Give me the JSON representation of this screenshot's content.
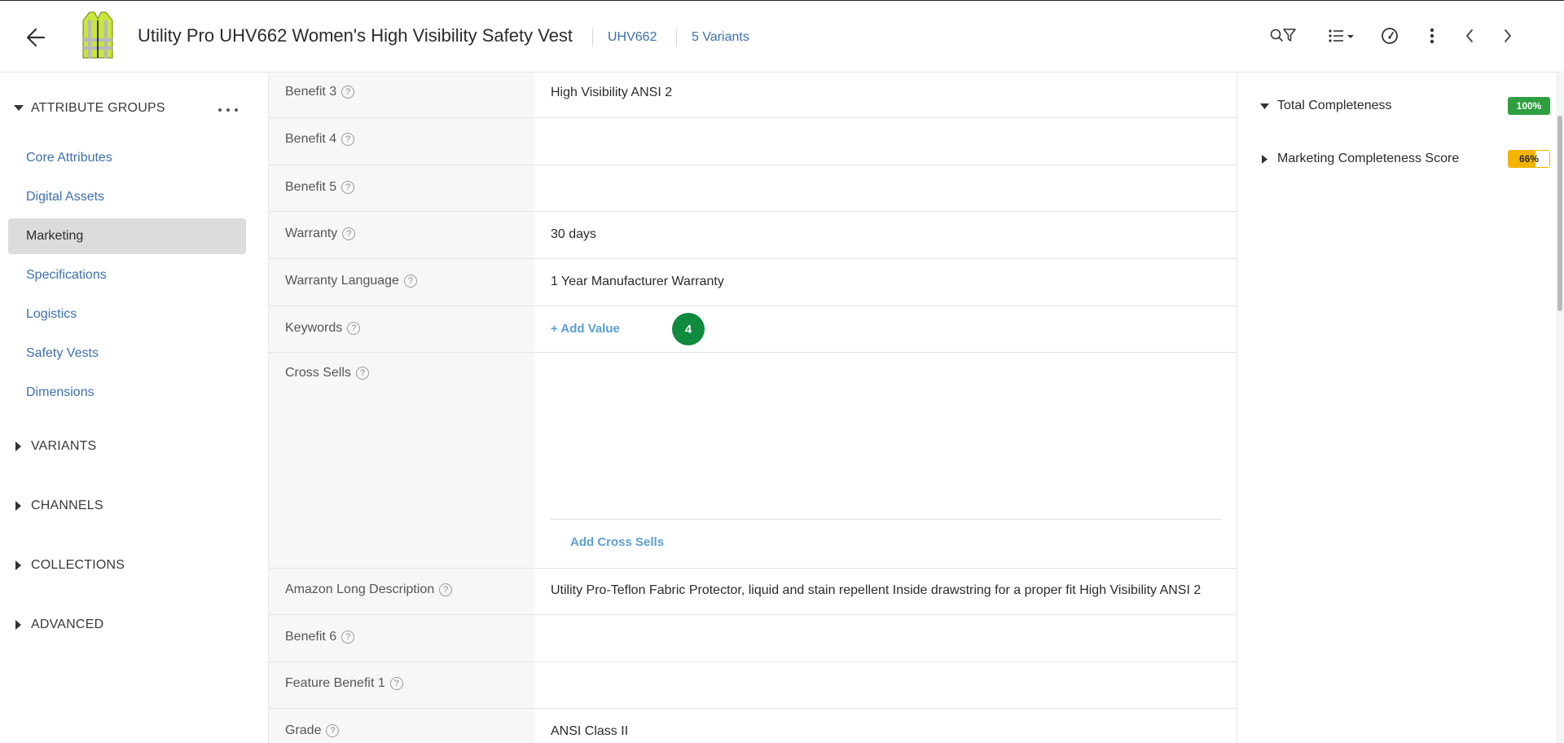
{
  "header": {
    "title": "Utility Pro UHV662 Women's High Visibility Safety Vest",
    "sku": "UHV662",
    "variants": "5 Variants"
  },
  "sidebar": {
    "attribute_groups_label": "ATTRIBUTE GROUPS",
    "attribute_groups": [
      {
        "label": "Core Attributes"
      },
      {
        "label": "Digital Assets"
      },
      {
        "label": "Marketing"
      },
      {
        "label": "Specifications"
      },
      {
        "label": "Logistics"
      },
      {
        "label": "Safety Vests"
      },
      {
        "label": "Dimensions"
      }
    ],
    "sections": [
      {
        "label": "VARIANTS"
      },
      {
        "label": "CHANNELS"
      },
      {
        "label": "COLLECTIONS"
      },
      {
        "label": "ADVANCED"
      }
    ]
  },
  "attributes": [
    {
      "label": "Benefit 3",
      "value": "High Visibility ANSI 2"
    },
    {
      "label": "Benefit 4",
      "value": ""
    },
    {
      "label": "Benefit 5",
      "value": ""
    },
    {
      "label": "Warranty",
      "value": "30 days"
    },
    {
      "label": "Warranty Language",
      "value": "1 Year Manufacturer Warranty"
    },
    {
      "label": "Keywords",
      "add_value": "+ Add Value",
      "badge": "4"
    },
    {
      "label": "Cross Sells",
      "add_label": "Add Cross Sells"
    },
    {
      "label": "Amazon Long Description",
      "value": "Utility Pro-Teflon Fabric Protector, liquid and stain repellent Inside drawstring for a proper fit High Visibility ANSI 2"
    },
    {
      "label": "Benefit 6",
      "value": ""
    },
    {
      "label": "Feature Benefit 1",
      "value": ""
    },
    {
      "label": "Grade",
      "value": "ANSI Class II"
    }
  ],
  "completeness": {
    "total_label": "Total Completeness",
    "total_value": "100%",
    "total_fraction": 1.0,
    "marketing_label": "Marketing Completeness Score",
    "marketing_value": "66%",
    "marketing_fraction": 0.66,
    "colors": {
      "complete": "#2e9e3f",
      "partial": "#f4b400"
    }
  },
  "icons": {
    "back": "arrow-left-icon",
    "search_filter": "search-filter-icon",
    "list_view": "list-view-icon",
    "gauge": "gauge-icon",
    "more": "more-vertical-icon",
    "prev": "chevron-left-icon",
    "next": "chevron-right-icon",
    "help": "help-icon"
  },
  "accent_color": "#3d6fb0"
}
